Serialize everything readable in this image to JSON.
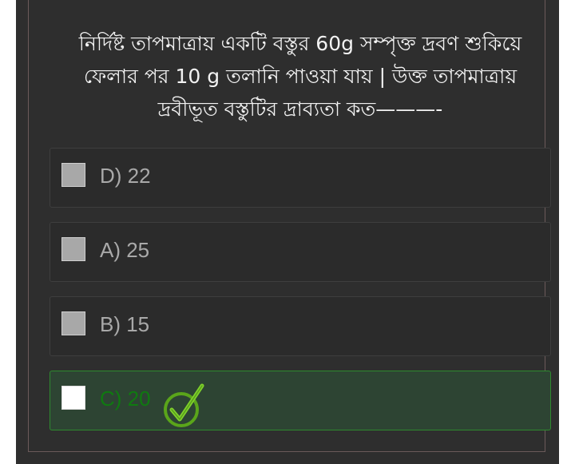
{
  "question": {
    "line1": "নির্দিষ্ট তাপমাত্রায় একটি বস্তুর 60g সম্পৃক্ত দ্রবণ শুকিয়ে",
    "line2": "ফেলার পর 10 g তলানি পাওয়া যায় | উক্ত তাপমাত্রায়",
    "line3": "দ্রবীভূত বস্তুটির দ্রাব্যতা কত———-"
  },
  "options": [
    {
      "label": "D) 22",
      "correct": false
    },
    {
      "label": "A) 25",
      "correct": false
    },
    {
      "label": "B) 15",
      "correct": false
    },
    {
      "label": "C) 20",
      "correct": true
    }
  ],
  "icons": {
    "correct_mark": "check-circle-icon"
  },
  "colors": {
    "background": "#2e2e2e",
    "question_text": "#f2f2f2",
    "option_text": "#a9a9a9",
    "correct_background": "#2d4433",
    "correct_border": "#2e8a2e",
    "correct_text": "#0f7a10",
    "check_green": "#6cc21d"
  }
}
